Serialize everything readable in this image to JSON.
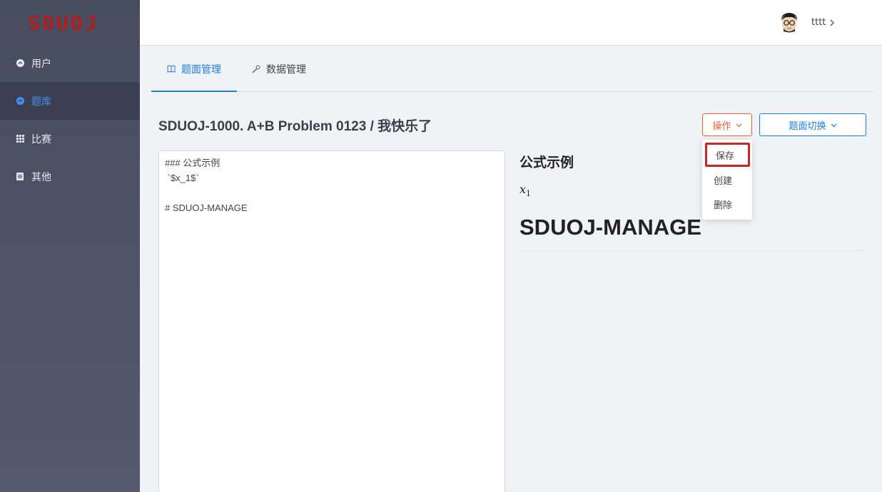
{
  "sidebar": {
    "logo": "SDUOJ",
    "items": [
      {
        "label": "用户",
        "icon": "user-circle-icon"
      },
      {
        "label": "题库",
        "icon": "book-circle-icon"
      },
      {
        "label": "比赛",
        "icon": "grid-icon"
      },
      {
        "label": "其他",
        "icon": "document-icon"
      }
    ],
    "active_index": 1
  },
  "header": {
    "username": "tttt",
    "chevron": "›"
  },
  "tabs": [
    {
      "label": "题面管理",
      "icon": "book-open-icon"
    },
    {
      "label": "数据管理",
      "icon": "wrench-icon"
    }
  ],
  "page": {
    "title": "SDUOJ-1000. A+B Problem 0123 / 我快乐了"
  },
  "actions": {
    "ops_label": "操作",
    "switch_label": "题面切换",
    "menu": [
      "保存",
      "创建",
      "删除"
    ]
  },
  "editor": {
    "lines": [
      "### 公式示例",
      " `$x_1$`",
      "",
      "# SDUOJ-MANAGE"
    ]
  },
  "preview": {
    "heading3": "公式示例",
    "math_base": "x",
    "math_sub": "1",
    "heading1": "SDUOJ-MANAGE"
  },
  "colors": {
    "accent_blue": "#1f7de4",
    "accent_orange": "#e8623a",
    "highlight_red": "#c62828",
    "logo_red": "#b71c1c"
  }
}
